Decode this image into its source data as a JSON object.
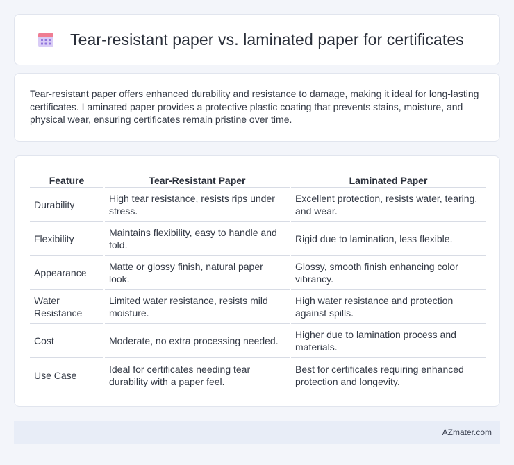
{
  "header": {
    "icon": "calendar-icon",
    "title": "Tear-resistant paper vs. laminated paper for certificates"
  },
  "intro": {
    "text": "Tear-resistant paper offers enhanced durability and resistance to damage, making it ideal for long-lasting certificates. Laminated paper provides a protective plastic coating that prevents stains, moisture, and physical wear, ensuring certificates remain pristine over time."
  },
  "table": {
    "headers": [
      "Feature",
      "Tear-Resistant Paper",
      "Laminated Paper"
    ],
    "rows": [
      [
        "Durability",
        "High tear resistance, resists rips under stress.",
        "Excellent protection, resists water, tearing, and wear."
      ],
      [
        "Flexibility",
        "Maintains flexibility, easy to handle and fold.",
        "Rigid due to lamination, less flexible."
      ],
      [
        "Appearance",
        "Matte or glossy finish, natural paper look.",
        "Glossy, smooth finish enhancing color vibrancy."
      ],
      [
        "Water Resistance",
        "Limited water resistance, resists mild moisture.",
        "High water resistance and protection against spills."
      ],
      [
        "Cost",
        "Moderate, no extra processing needed.",
        "Higher due to lamination process and materials."
      ],
      [
        "Use Case",
        "Ideal for certificates needing tear durability with a paper feel.",
        "Best for certificates requiring enhanced protection and longevity."
      ]
    ]
  },
  "footer": {
    "text": "AZmater.com"
  },
  "colors": {
    "icon_top": "#ee7a8c",
    "icon_body": "#c9b8f0",
    "icon_dots": "#8a6fd6"
  }
}
